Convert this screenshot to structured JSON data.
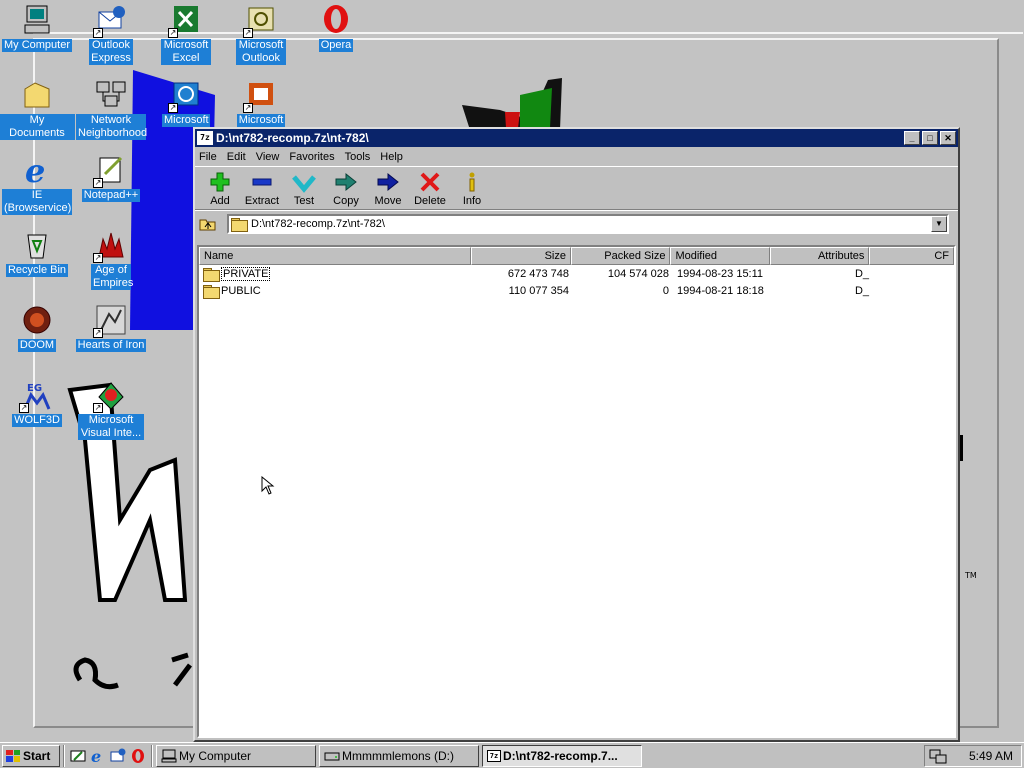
{
  "desktop": {
    "icons": [
      {
        "label": "My Computer",
        "icon": "my-computer-icon"
      },
      {
        "label": "Outlook Express",
        "icon": "outlook-express-icon"
      },
      {
        "label": "Microsoft Excel",
        "icon": "excel-icon"
      },
      {
        "label": "Microsoft Outlook",
        "icon": "outlook-icon"
      },
      {
        "label": "Opera",
        "icon": "opera-icon"
      },
      {
        "label": "My Documents",
        "icon": "my-documents-icon"
      },
      {
        "label": "Network Neighborhood",
        "icon": "network-icon"
      },
      {
        "label": "Microsoft FrontP",
        "icon": "frontpage-icon"
      },
      {
        "label": "Microsoft",
        "icon": "powerpoint-icon"
      },
      {
        "label": "IE (Browservice)",
        "icon": "ie-icon"
      },
      {
        "label": "Notepad++",
        "icon": "notepad-icon"
      },
      {
        "label": "Recycle Bin",
        "icon": "recycle-bin-icon"
      },
      {
        "label": "Age of Empires",
        "icon": "age-of-empires-icon"
      },
      {
        "label": "DOOM",
        "icon": "doom-icon"
      },
      {
        "label": "Hearts of Iron",
        "icon": "hearts-of-iron-icon"
      },
      {
        "label": "WOLF3D",
        "icon": "wolf3d-icon"
      },
      {
        "label": "Microsoft Visual Inte...",
        "icon": "visual-interdev-icon"
      }
    ]
  },
  "window": {
    "title": "D:\\nt782-recomp.7z\\nt-782\\",
    "menu": [
      "File",
      "Edit",
      "View",
      "Favorites",
      "Tools",
      "Help"
    ],
    "toolbar": [
      {
        "label": "Add",
        "icon": "add-icon"
      },
      {
        "label": "Extract",
        "icon": "extract-icon"
      },
      {
        "label": "Test",
        "icon": "test-icon"
      },
      {
        "label": "Copy",
        "icon": "copy-icon"
      },
      {
        "label": "Move",
        "icon": "move-icon"
      },
      {
        "label": "Delete",
        "icon": "delete-icon"
      },
      {
        "label": "Info",
        "icon": "info-icon"
      }
    ],
    "address": "D:\\nt782-recomp.7z\\nt-782\\",
    "columns": {
      "name": "Name",
      "size": "Size",
      "packed": "Packed Size",
      "modified": "Modified",
      "attributes": "Attributes",
      "crc": "CF"
    },
    "rows": [
      {
        "name": "PRIVATE",
        "size": "672 473 748",
        "packed": "104 574 028",
        "modified": "1994-08-23 15:11",
        "attributes": "D_"
      },
      {
        "name": "PUBLIC",
        "size": "110 077 354",
        "packed": "0",
        "modified": "1994-08-21 18:18",
        "attributes": "D_"
      }
    ]
  },
  "taskbar": {
    "start": "Start",
    "tasks": [
      {
        "label": "My Computer",
        "active": false
      },
      {
        "label": "Mmmmmlemons (D:)",
        "active": false
      },
      {
        "label": "D:\\nt782-recomp.7...",
        "active": true
      }
    ],
    "time": "5:49 AM"
  },
  "colors": {
    "titlebar": "#0a246a",
    "selection": "#1e7fd6",
    "face": "#c0c0c0"
  }
}
